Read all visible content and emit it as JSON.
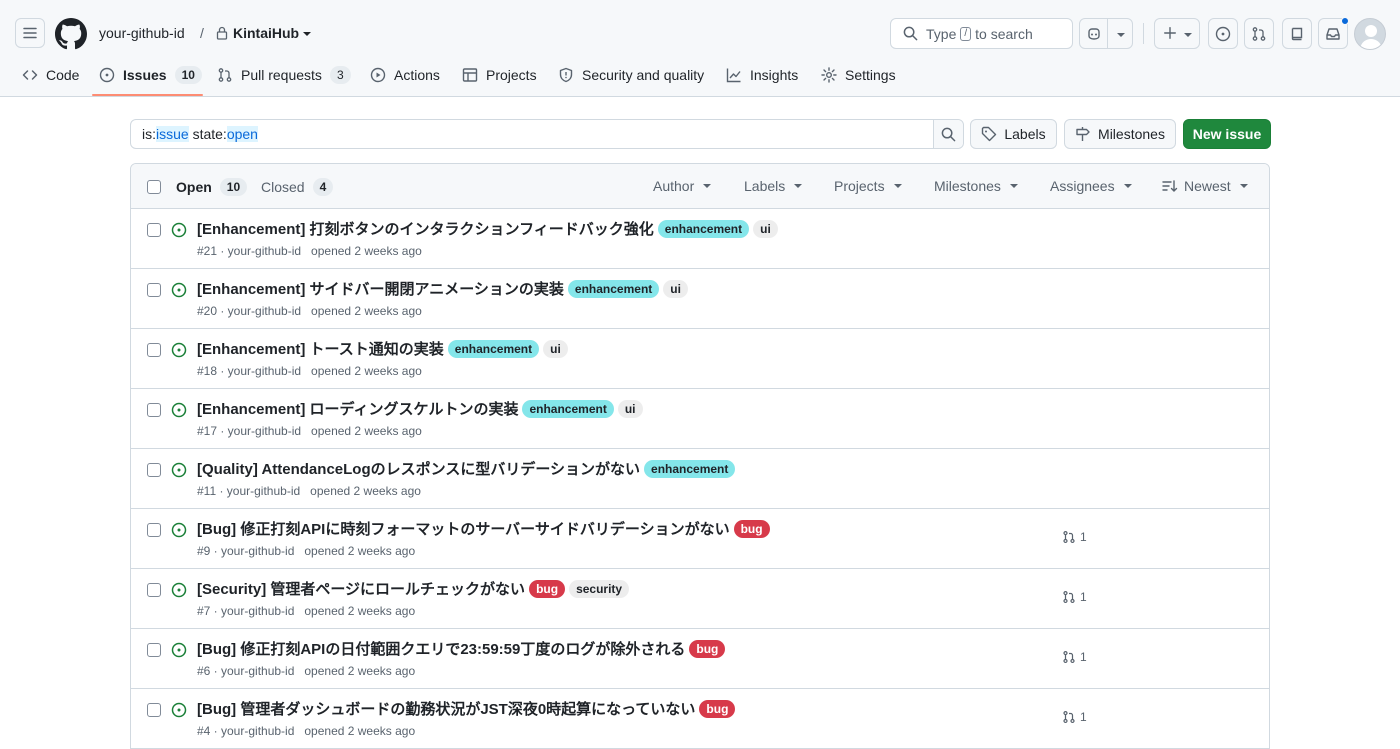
{
  "header": {
    "owner": "your-github-id",
    "separator": "/",
    "repo": "KintaiHub",
    "search_prefix": "Type",
    "search_key": "/",
    "search_suffix": "to search",
    "icons": {
      "menu": "hamburger-icon",
      "logo": "github-logo-icon",
      "copilot": "copilot-icon",
      "plus": "plus-icon",
      "issues": "issue-opened-icon",
      "pulls": "git-pull-request-icon",
      "repos": "repo-icon",
      "inbox": "inbox-icon"
    }
  },
  "tabs": [
    {
      "label": "Code",
      "icon": "code-icon"
    },
    {
      "label": "Issues",
      "count": "10",
      "icon": "issue-opened-icon",
      "active": true
    },
    {
      "label": "Pull requests",
      "count": "3",
      "icon": "git-pull-request-icon"
    },
    {
      "label": "Actions",
      "icon": "play-icon"
    },
    {
      "label": "Projects",
      "icon": "table-icon"
    },
    {
      "label": "Security and quality",
      "icon": "shield-icon"
    },
    {
      "label": "Insights",
      "icon": "graph-icon"
    },
    {
      "label": "Settings",
      "icon": "gear-icon"
    }
  ],
  "filter": {
    "part1": "is:",
    "part2": "issue",
    "part3": " state:",
    "part4": "open"
  },
  "buttons": {
    "labels": "Labels",
    "milestones": "Milestones",
    "new_issue": "New issue"
  },
  "list_header": {
    "open_label": "Open",
    "open_count": "10",
    "closed_label": "Closed",
    "closed_count": "4",
    "filters": [
      "Author",
      "Labels",
      "Projects",
      "Milestones",
      "Assignees",
      "Newest"
    ]
  },
  "colors": {
    "enhancement": "#84e6ea",
    "ui": "#ededed",
    "bug": "#d73a4a",
    "security": "#ededed",
    "open_icon": "#1a7f37",
    "accent": "#0969da",
    "primary_button": "#1f883d"
  },
  "issues": [
    {
      "title": "[Enhancement] 打刻ボタンのインタラクションフィードバック強化",
      "labels": [
        "enhancement",
        "ui"
      ],
      "meta": "#21 · your-github-id   opened 2 weeks ago",
      "pr_count": ""
    },
    {
      "title": "[Enhancement] サイドバー開閉アニメーションの実装",
      "labels": [
        "enhancement",
        "ui"
      ],
      "meta": "#20 · your-github-id   opened 2 weeks ago",
      "pr_count": ""
    },
    {
      "title": "[Enhancement] トースト通知の実装",
      "labels": [
        "enhancement",
        "ui"
      ],
      "meta": "#18 · your-github-id   opened 2 weeks ago",
      "pr_count": ""
    },
    {
      "title": "[Enhancement] ローディングスケルトンの実装",
      "labels": [
        "enhancement",
        "ui"
      ],
      "meta": "#17 · your-github-id   opened 2 weeks ago",
      "pr_count": ""
    },
    {
      "title": "[Quality] AttendanceLogのレスポンスに型バリデーションがない",
      "labels": [
        "enhancement"
      ],
      "meta": "#11 · your-github-id   opened 2 weeks ago",
      "pr_count": ""
    },
    {
      "title": "[Bug] 修正打刻APIに時刻フォーマットのサーバーサイドバリデーションがない",
      "labels": [
        "bug"
      ],
      "meta": "#9 · your-github-id   opened 2 weeks ago",
      "pr_count": "1"
    },
    {
      "title": "[Security] 管理者ページにロールチェックがない",
      "labels": [
        "bug",
        "security"
      ],
      "meta": "#7 · your-github-id   opened 2 weeks ago",
      "pr_count": "1"
    },
    {
      "title": "[Bug] 修正打刻APIの日付範囲クエリで23:59:59丁度のログが除外される",
      "labels": [
        "bug"
      ],
      "meta": "#6 · your-github-id   opened 2 weeks ago",
      "pr_count": "1"
    },
    {
      "title": "[Bug] 管理者ダッシュボードの勤務状況がJST深夜0時起算になっていない",
      "labels": [
        "bug"
      ],
      "meta": "#4 · your-github-id   opened 2 weeks ago",
      "pr_count": "1"
    }
  ]
}
